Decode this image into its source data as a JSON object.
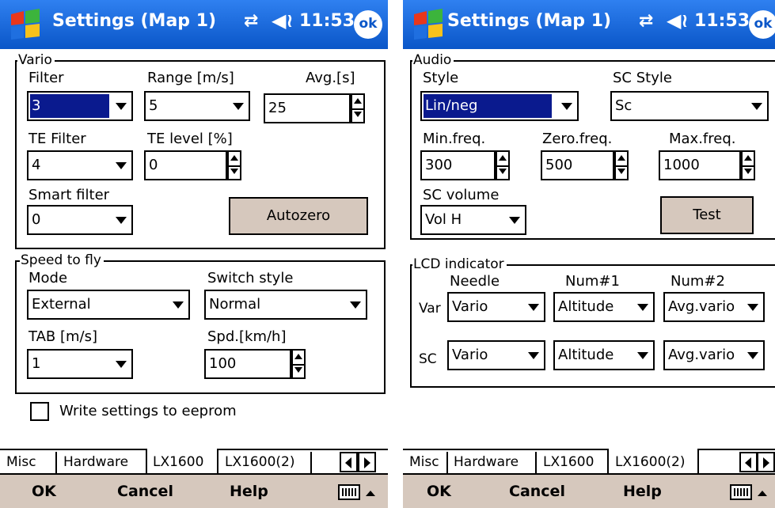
{
  "screens": [
    {
      "title": "Settings (Map 1)",
      "time": "11:53",
      "ok_label": "ok",
      "vario": {
        "group_label": "Vario",
        "filter_label": "Filter",
        "filter_value": "3",
        "range_label": "Range [m/s]",
        "range_value": "5",
        "avg_label": "Avg.[s]",
        "avg_value": "25",
        "te_filter_label": "TE Filter",
        "te_filter_value": "4",
        "te_level_label": "TE level [%]",
        "te_level_value": "0",
        "smart_filter_label": "Smart filter",
        "smart_filter_value": "0",
        "autozero_label": "Autozero"
      },
      "speed": {
        "group_label": "Speed to fly",
        "mode_label": "Mode",
        "mode_value": "External",
        "switch_label": "Switch style",
        "switch_value": "Normal",
        "tab_label": "TAB [m/s]",
        "tab_value": "1",
        "spd_label": "Spd.[km/h]",
        "spd_value": "100"
      },
      "eeprom_label": "Write settings to eeprom",
      "eeprom_checked": false,
      "tabs": [
        "Misc",
        "Hardware",
        "LX1600",
        "LX1600(2)"
      ],
      "active_tab": "LX1600",
      "menu": {
        "ok": "OK",
        "cancel": "Cancel",
        "help": "Help"
      }
    },
    {
      "title": "Settings (Map 1)",
      "time": "11:53",
      "ok_label": "ok",
      "audio": {
        "group_label": "Audio",
        "style_label": "Style",
        "style_value": "Lin/neg",
        "sc_style_label": "SC Style",
        "sc_style_value": "Sc",
        "min_label": "Min.freq.",
        "min_value": "300",
        "zero_label": "Zero.freq.",
        "zero_value": "500",
        "max_label": "Max.freq.",
        "max_value": "1000",
        "sc_volume_label": "SC volume",
        "sc_volume_value": "Vol H",
        "test_label": "Test"
      },
      "lcd": {
        "group_label": "LCD indicator",
        "col_needle": "Needle",
        "col_num1": "Num#1",
        "col_num2": "Num#2",
        "rows": [
          {
            "label": "Var",
            "needle": "Vario",
            "num1": "Altitude",
            "num2": "Avg.vario"
          },
          {
            "label": "SC",
            "needle": "Vario",
            "num1": "Altitude",
            "num2": "Avg.vario"
          }
        ]
      },
      "tabs": [
        "Misc",
        "Hardware",
        "LX1600",
        "LX1600(2)"
      ],
      "active_tab": "LX1600(2)",
      "menu": {
        "ok": "OK",
        "cancel": "Cancel",
        "help": "Help"
      }
    }
  ],
  "colors": {
    "titlebar": "#0a56c8",
    "button_face": "#d6c8bd",
    "selection": "#0a1a8e"
  },
  "icons": [
    "windows-start-icon",
    "connectivity-icon",
    "speaker-icon",
    "ok-icon",
    "keyboard-icon"
  ]
}
